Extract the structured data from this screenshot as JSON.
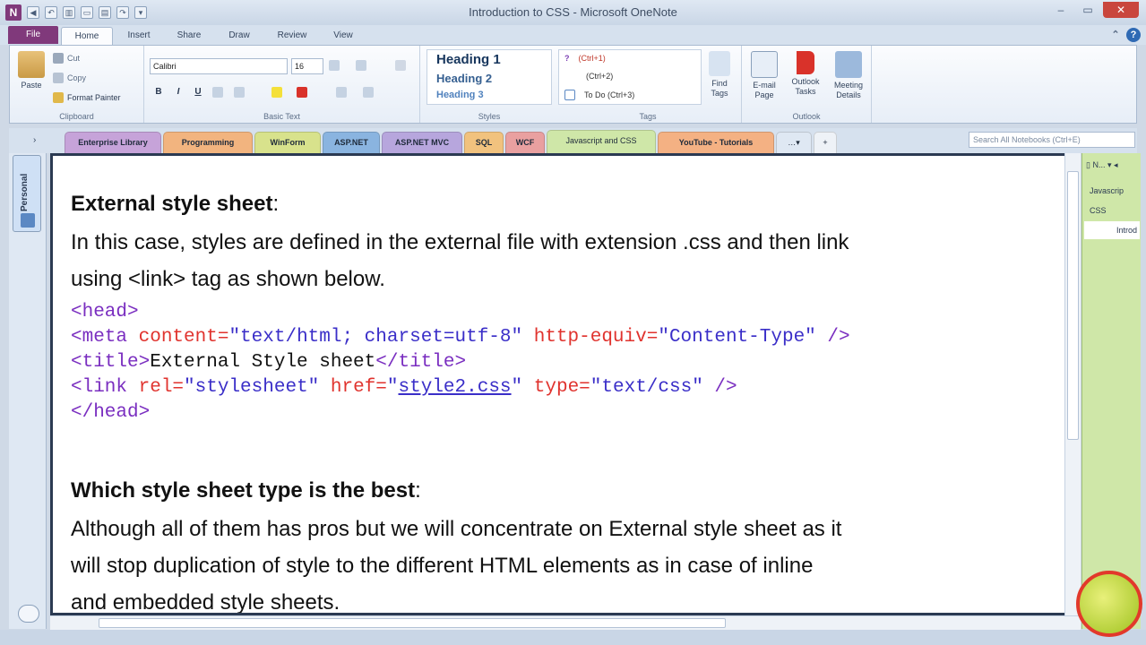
{
  "window": {
    "title": "Introduction to CSS - Microsoft OneNote",
    "app_badge": "N"
  },
  "ribbon_tabs": [
    "File",
    "Home",
    "Insert",
    "Share",
    "Draw",
    "Review",
    "View"
  ],
  "clipboard": {
    "paste": "Paste",
    "cut": "Cut",
    "copy": "Copy",
    "format_painter": "Format Painter",
    "group_label": "Clipboard"
  },
  "basic_text": {
    "font": "Calibri",
    "size": "16",
    "group_label": "Basic Text",
    "bold": "B",
    "italic": "I",
    "underline": "U"
  },
  "styles": {
    "h1": "Heading 1",
    "h2": "Heading 2",
    "h3": "Heading 3",
    "group_label": "Styles"
  },
  "tags": {
    "t1": "(Ctrl+1)",
    "t2": "(Ctrl+2)",
    "t3": "To Do (Ctrl+3)",
    "find_tags": "Find Tags",
    "group_label": "Tags"
  },
  "outlook": {
    "email": "E-mail Page",
    "tasks": "Outlook Tasks",
    "meeting": "Meeting Details",
    "group_label": "Outlook"
  },
  "section_tabs": [
    {
      "label": "Enterprise Library",
      "color": "#c6a3d9"
    },
    {
      "label": "Programming",
      "color": "#f2b47f"
    },
    {
      "label": "WinForm",
      "color": "#d8e28c"
    },
    {
      "label": "ASP.NET",
      "color": "#8ab4e0"
    },
    {
      "label": "ASP.NET MVC",
      "color": "#b7a6dd"
    },
    {
      "label": "SQL",
      "color": "#f1c27e"
    },
    {
      "label": "WCF",
      "color": "#e9a0a0"
    },
    {
      "label": "Javascript and CSS",
      "color": "#cfe7a8"
    },
    {
      "label": "YouTube - Tutorials",
      "color": "#f4b183"
    }
  ],
  "search": {
    "placeholder": "Search All Notebooks (Ctrl+E)"
  },
  "notebook": {
    "name": "Personal"
  },
  "page_list": {
    "header": "N...",
    "items": [
      "Javascrip",
      "CSS",
      "Introd"
    ]
  },
  "content": {
    "heading1": "External style sheet",
    "heading1_colon": ":",
    "para1_a": "In this case, styles are defined in the external file with extension .css and then link",
    "para1_b": "using <link> tag as shown below.",
    "code": {
      "head_open": "<head>",
      "meta_tag": "<meta",
      "meta_attr1": "content=",
      "meta_val1": "\"text/html; charset=utf-8\"",
      "meta_attr2": "http-equiv=",
      "meta_val2": "\"Content-Type\"",
      "meta_close": "/>",
      "title_open": "<title>",
      "title_text": "External Style sheet",
      "title_close": "</title>",
      "link_tag": "<link",
      "link_attr1": "rel=",
      "link_val1": "\"stylesheet\"",
      "link_attr2": "href=",
      "link_val2": "style2.css",
      "link_attr3": "type=",
      "link_val3": "\"text/css\"",
      "link_close": "/>",
      "head_close": "</head>"
    },
    "heading2": "Which style sheet type is the best",
    "heading2_colon": ":",
    "para2_a": "Although all of them has pros but we will concentrate on External style sheet as it",
    "para2_b": "will stop duplication of style to the different HTML elements as in case of inline",
    "para2_c": "and embedded style sheets."
  },
  "colors": {
    "file_tab": "#80397b",
    "code_tag": "#7a2ec0",
    "code_attr": "#e0332e",
    "code_value": "#3a2ec8",
    "section_active": "#cfe7a8"
  }
}
